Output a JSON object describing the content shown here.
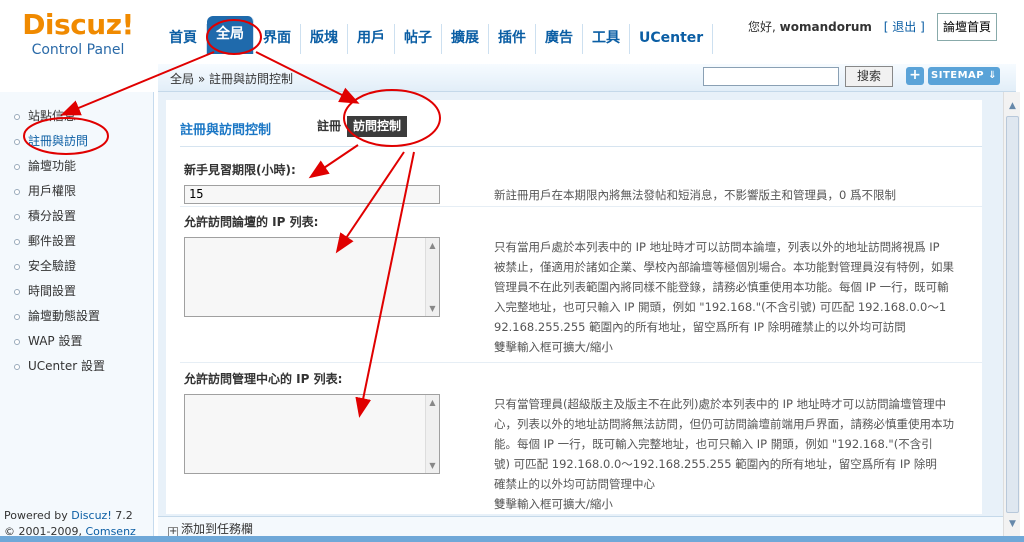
{
  "logo": {
    "brand": "Discuz!",
    "sub": "Control Panel"
  },
  "nav": [
    {
      "label": "首頁"
    },
    {
      "label": "全局"
    },
    {
      "label": "界面"
    },
    {
      "label": "版塊"
    },
    {
      "label": "用戶"
    },
    {
      "label": "帖子"
    },
    {
      "label": "擴展"
    },
    {
      "label": "插件"
    },
    {
      "label": "廣告"
    },
    {
      "label": "工具"
    },
    {
      "label": "UCenter"
    }
  ],
  "user": {
    "greeting": "您好,",
    "name": "womandorum",
    "logout": "[ 退出 ]",
    "home": "論壇首頁"
  },
  "crumb": "全局 » 註冊與訪問控制",
  "search": {
    "value": "",
    "button": "搜索"
  },
  "toolbar": {
    "plus": "+",
    "sitemap": "SITEMAP ⇓"
  },
  "sidebar": {
    "items": [
      {
        "label": "站點信息"
      },
      {
        "label": "註冊與訪問"
      },
      {
        "label": "論壇功能"
      },
      {
        "label": "用戶權限"
      },
      {
        "label": "積分設置"
      },
      {
        "label": "郵件設置"
      },
      {
        "label": "安全驗證"
      },
      {
        "label": "時間設置"
      },
      {
        "label": "論壇動態設置"
      },
      {
        "label": "WAP 設置"
      },
      {
        "label": "UCenter 設置"
      }
    ],
    "powered_line1": "Powered by",
    "powered_brand": "Discuz!",
    "powered_version": "7.2",
    "powered_line2": "© 2001-2009,",
    "powered_company": "Comsenz Inc."
  },
  "panel": {
    "title": "註冊與訪問控制",
    "tabs": [
      {
        "label": "註冊"
      },
      {
        "label": "訪問控制"
      }
    ]
  },
  "fields": {
    "newbie": {
      "label": "新手見習期限(小時):",
      "value": "15",
      "help": "新註冊用戶在本期限內將無法發帖和短消息，不影響版主和管理員，0 爲不限制"
    },
    "forum_ip": {
      "label": "允許訪問論壇的 IP 列表:",
      "help_lines": [
        "只有當用戶處於本列表中的 IP 地址時才可以訪問本論壇，列表以外的地址訪問將視爲 IP",
        "被禁止，僅適用於諸如企業、學校內部論壇等極個別場合。本功能對管理員沒有特例，如果",
        "管理員不在此列表範圍內將同樣不能登錄，請務必慎重使用本功能。每個 IP 一行，既可輸",
        "入完整地址，也可只輸入 IP 開頭，例如 \"192.168.\"(不含引號) 可匹配 192.168.0.0～1",
        "92.168.255.255 範圍內的所有地址，留空爲所有 IP 除明確禁止的以外均可訪問",
        "雙擊輸入框可擴大/縮小"
      ]
    },
    "admin_ip": {
      "label": "允許訪問管理中心的 IP 列表:",
      "help_lines": [
        "只有當管理員(超級版主及版主不在此列)處於本列表中的 IP 地址時才可以訪問論壇管理中",
        "心，列表以外的地址訪問將無法訪問，但仍可訪問論壇前端用戶界面，請務必慎重使用本功",
        "能。每個 IP 一行，既可輸入完整地址，也可只輸入 IP 開頭，例如 \"192.168.\"(不含引",
        "號) 可匹配 192.168.0.0～192.168.255.255 範圍內的所有地址，留空爲所有 IP 除明",
        "確禁止的以外均可訪問管理中心",
        "雙擊輸入框可擴大/縮小"
      ]
    }
  },
  "footer": {
    "add_task": "添加到任務欄"
  },
  "colors": {
    "accent": "#1f6aac",
    "annotation": "#e00000",
    "logo": "#f08a00"
  }
}
